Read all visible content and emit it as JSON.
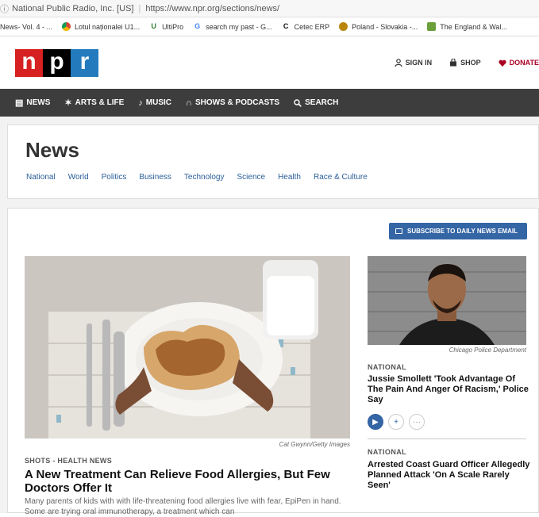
{
  "browser": {
    "site_identity": "National Public Radio, Inc. [US]",
    "url": "https://www.npr.org/sections/news/",
    "bookmarks": [
      {
        "label": "News- Vol. 4 - ...",
        "icon": "page-icon",
        "color": "#999999"
      },
      {
        "label": "Lotul naționalei U1...",
        "icon": "chrome-icon",
        "color": "#4caf50"
      },
      {
        "label": "UltiPro",
        "icon": "ultipro-icon",
        "color": "#2e7d32"
      },
      {
        "label": "search my past - G...",
        "icon": "google-icon",
        "color": "#4285f4"
      },
      {
        "label": "Cetec ERP",
        "icon": "cetec-icon",
        "color": "#111111"
      },
      {
        "label": "Poland - Slovakia -...",
        "icon": "soccer-icon",
        "color": "#b8860b"
      },
      {
        "label": "The England & Wal...",
        "icon": "england-icon",
        "color": "#6a9f3a"
      }
    ]
  },
  "header": {
    "logo_letters": [
      "n",
      "p",
      "r"
    ],
    "logo_colors": [
      "#d62021",
      "#000000",
      "#237bbd"
    ],
    "utility": {
      "sign_in": "SIGN IN",
      "shop": "SHOP",
      "donate": "DONATE"
    }
  },
  "nav": {
    "news": "NEWS",
    "arts": "ARTS & LIFE",
    "music": "MUSIC",
    "shows": "SHOWS & PODCASTS",
    "search": "SEARCH"
  },
  "section": {
    "title": "News",
    "links": [
      "National",
      "World",
      "Politics",
      "Business",
      "Technology",
      "Science",
      "Health",
      "Race & Culture"
    ]
  },
  "subscribe_label": "SUBSCRIBE TO DAILY NEWS EMAIL",
  "lead_story": {
    "credit": "Cat Gwynn/Getty Images",
    "slug": "SHOTS - HEALTH NEWS",
    "title": "A New Treatment Can Relieve Food Allergies, But Few Doctors Offer It",
    "teaser": "Many parents of kids with with life-threatening food allergies live with fear, EpiPen in hand. Some are trying oral immunotherapy, a treatment which can"
  },
  "side_stories": [
    {
      "credit": "Chicago Police Department",
      "slug": "NATIONAL",
      "title": "Jussie Smollett 'Took Advantage Of The Pain And Anger Of Racism,' Police Say"
    },
    {
      "slug": "NATIONAL",
      "title": "Arrested Coast Guard Officer Allegedly Planned Attack 'On A Scale Rarely Seen'"
    }
  ],
  "colors": {
    "nav_bg": "#3d3d3d",
    "link_blue": "#2b5e98",
    "button_blue": "#3465a4",
    "donate_red": "#a02"
  }
}
